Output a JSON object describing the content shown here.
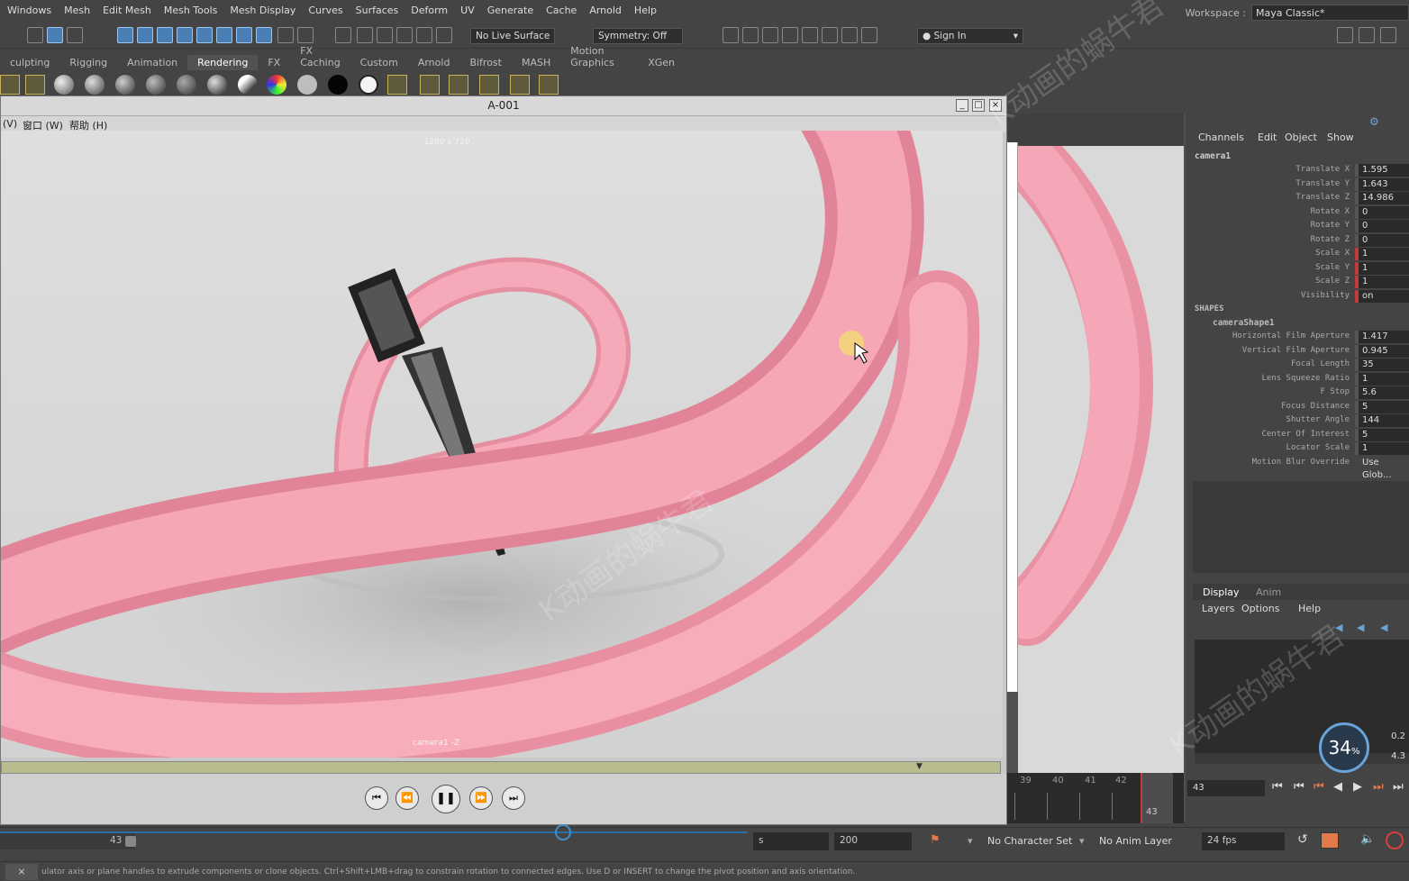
{
  "menubar": {
    "items": [
      "Windows",
      "Mesh",
      "Edit Mesh",
      "Mesh Tools",
      "Mesh Display",
      "Curves",
      "Surfaces",
      "Deform",
      "UV",
      "Generate",
      "Cache",
      "Arnold",
      "Help"
    ]
  },
  "workspace": {
    "label": "Workspace :",
    "value": "Maya Classic*"
  },
  "statusline": {
    "live_surface": "No Live Surface",
    "symmetry": "Symmetry: Off",
    "sign_in": "Sign In"
  },
  "shelf": {
    "tabs": [
      "culpting",
      "Rigging",
      "Animation",
      "Rendering",
      "FX",
      "FX Caching",
      "Custom",
      "Arnold",
      "Bifrost",
      "MASH",
      "Motion Graphics",
      "XGen"
    ],
    "active_tab": "Rendering"
  },
  "render_view": {
    "title": "A-001",
    "menu": [
      "(V)",
      "窗口 (W)",
      "帮助 (H)"
    ],
    "resolution": "1280 x 720",
    "camera_label": "camera1 -Z",
    "colors": {
      "ribbon": "#f6a3b4",
      "background": "#dadada"
    }
  },
  "channel_box": {
    "menu": [
      "Channels",
      "Edit",
      "Object",
      "Show"
    ],
    "object": "camera1",
    "transform_attrs": [
      {
        "name": "Translate X",
        "value": "1.595"
      },
      {
        "name": "Translate Y",
        "value": "1.643"
      },
      {
        "name": "Translate Z",
        "value": "14.986"
      },
      {
        "name": "Rotate X",
        "value": "0"
      },
      {
        "name": "Rotate Y",
        "value": "0"
      },
      {
        "name": "Rotate Z",
        "value": "0"
      },
      {
        "name": "Scale X",
        "value": "1"
      },
      {
        "name": "Scale Y",
        "value": "1"
      },
      {
        "name": "Scale Z",
        "value": "1"
      },
      {
        "name": "Visibility",
        "value": "on"
      }
    ],
    "shapes_label": "SHAPES",
    "shape_name": "cameraShape1",
    "shape_attrs": [
      {
        "name": "Horizontal Film Aperture",
        "value": "1.417"
      },
      {
        "name": "Vertical Film Aperture",
        "value": "0.945"
      },
      {
        "name": "Focal Length",
        "value": "35"
      },
      {
        "name": "Lens Squeeze Ratio",
        "value": "1"
      },
      {
        "name": "F Stop",
        "value": "5.6"
      },
      {
        "name": "Focus Distance",
        "value": "5"
      },
      {
        "name": "Shutter Angle",
        "value": "144"
      },
      {
        "name": "Center Of Interest",
        "value": "5"
      },
      {
        "name": "Locator Scale",
        "value": "1"
      },
      {
        "name": "Motion Blur Override",
        "value": "Use Glob..."
      }
    ]
  },
  "layer_editor": {
    "tabs": [
      "Display",
      "Anim"
    ],
    "menu": [
      "Layers",
      "Options",
      "Help"
    ]
  },
  "timeline": {
    "numbers": [
      "39",
      "40",
      "41",
      "42",
      "43"
    ],
    "current_frame": "43",
    "current_frame_field": "43"
  },
  "perf": {
    "percent": "34",
    "unit": "%",
    "up": "0.2",
    "down": "4.3"
  },
  "range": {
    "current": "43",
    "start": "s",
    "end": "200",
    "character_set": "No Character Set",
    "anim_layer": "No Anim Layer",
    "fps": "24 fps"
  },
  "help_line": {
    "text": "ulator axis or plane handles to extrude components or clone objects. Ctrl+Shift+LMB+drag to constrain rotation to connected edges. Use D or INSERT to change the pivot position and axis orientation."
  },
  "watermark": "K动画的蜗牛君"
}
